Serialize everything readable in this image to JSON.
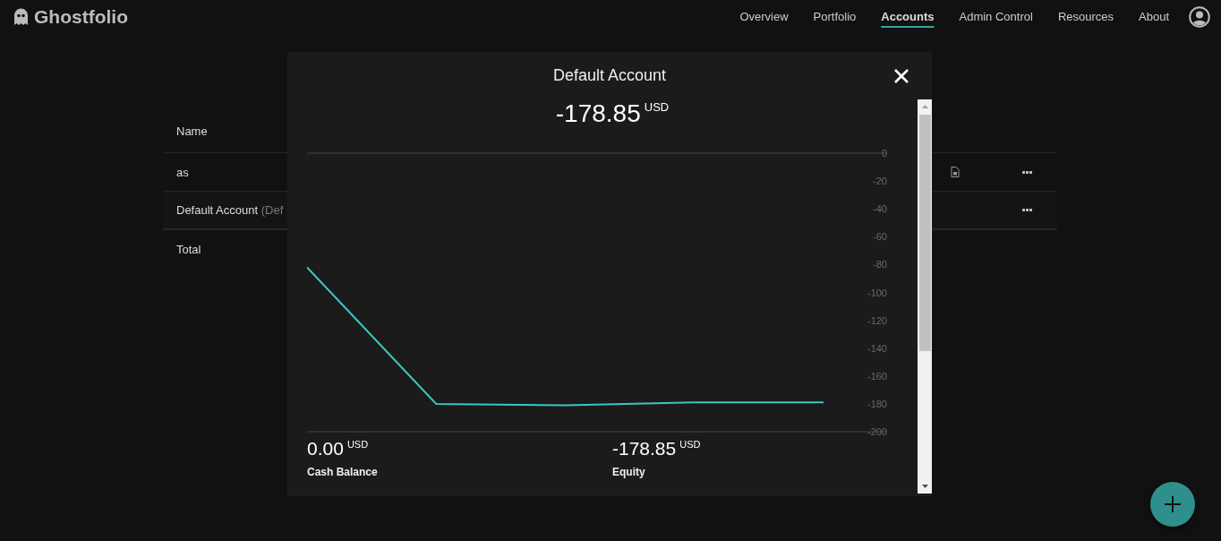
{
  "header": {
    "logo": "Ghostfolio",
    "nav": [
      {
        "label": "Overview",
        "selected": false
      },
      {
        "label": "Portfolio",
        "selected": false
      },
      {
        "label": "Accounts",
        "selected": true
      },
      {
        "label": "Admin Control",
        "selected": false
      },
      {
        "label": "Resources",
        "selected": false
      },
      {
        "label": "About",
        "selected": false
      }
    ]
  },
  "table": {
    "columns": [
      "Name"
    ],
    "rows": [
      {
        "kind": "account",
        "name": "as",
        "report": true
      },
      {
        "kind": "account",
        "name": "Default Account",
        "note": "(Def",
        "report": false
      },
      {
        "kind": "total",
        "name": "Total",
        "report": false
      }
    ]
  },
  "dialog": {
    "title": "Default Account",
    "value": "-178.85",
    "currency": "USD",
    "chart_data": {
      "type": "line",
      "ylim": [
        -200,
        0
      ],
      "yticks": [
        0,
        -20,
        -40,
        -60,
        -80,
        -100,
        -120,
        -140,
        -160,
        -180,
        -200
      ],
      "series": [
        {
          "color": "#3ec6c0",
          "values": [
            -82,
            -180,
            -181,
            -179,
            -179
          ]
        }
      ]
    },
    "stats": [
      {
        "value": "0.00",
        "currency": "USD",
        "label": "Cash Balance"
      },
      {
        "value": "-178.85",
        "currency": "USD",
        "label": "Equity"
      }
    ]
  }
}
